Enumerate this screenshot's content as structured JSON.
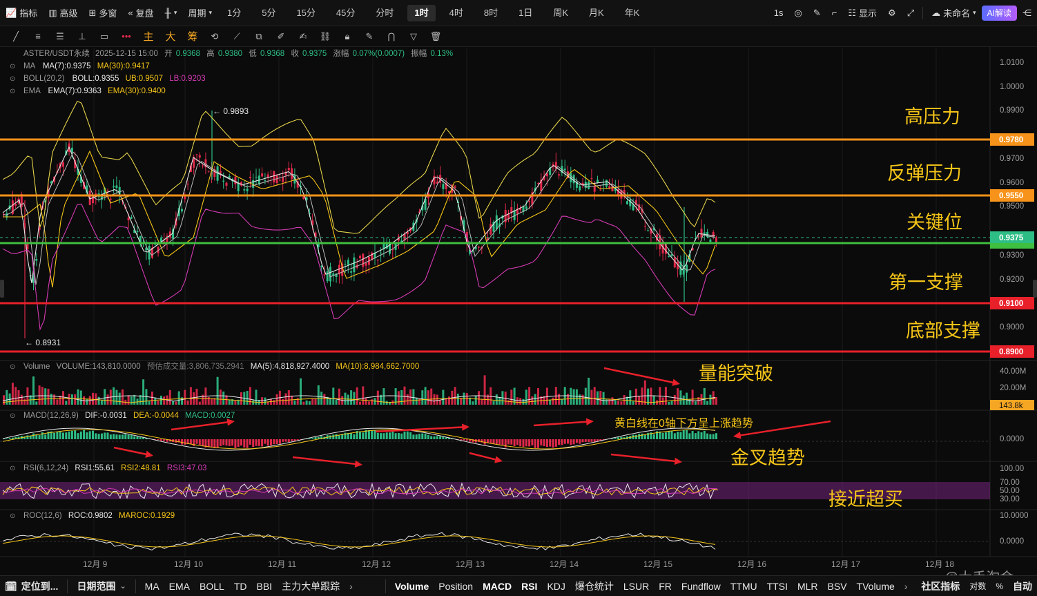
{
  "toolbar": {
    "indicator": "指标",
    "advanced": "高级",
    "multi_window": "多窗",
    "replay": "复盘",
    "period_menu": "周期",
    "periods": [
      "1分",
      "5分",
      "15分",
      "45分",
      "分时",
      "1时",
      "4时",
      "8时",
      "1日",
      "周K",
      "月K",
      "年K"
    ],
    "active_period": "1时",
    "interval_label": "1s",
    "display": "显示",
    "layout_name": "未命名",
    "ai_button": "AI解读"
  },
  "drawing_tools": {
    "main": "主",
    "big": "大",
    "chips": "筹"
  },
  "legends": {
    "ohlc": {
      "symbol": "ASTER/USDT永续",
      "datetime": "2025-12-15 15:00",
      "open_label": "开",
      "open": "0.9368",
      "high_label": "高",
      "high": "0.9380",
      "low_label": "低",
      "low": "0.9368",
      "close_label": "收",
      "close": "0.9375",
      "change_label": "涨幅",
      "change": "0.07%(0.0007)",
      "amplitude_label": "振幅",
      "amplitude": "0.13%"
    },
    "ma": {
      "name": "MA",
      "ma7": "MA(7):0.9375",
      "ma30": "MA(30):0.9417"
    },
    "boll": {
      "name": "BOLL(20,2)",
      "boll": "BOLL:0.9355",
      "ub": "UB:0.9507",
      "lb": "LB:0.9203"
    },
    "ema": {
      "name": "EMA",
      "ema7": "EMA(7):0.9363",
      "ema30": "EMA(30):0.9400"
    },
    "volume": {
      "name": "Volume",
      "vol": "VOLUME:143,810.0000",
      "est": "预估成交量:3,806,735.2941",
      "ma5": "MA(5):4,818,927.4000",
      "ma10": "MA(10):8,984,662.7000"
    },
    "macd": {
      "name": "MACD(12,26,9)",
      "dif": "DIF:-0.0031",
      "dea": "DEA:-0.0044",
      "macd": "MACD:0.0027"
    },
    "rsi": {
      "name": "RSI(6,12,24)",
      "rsi1": "RSI1:55.61",
      "rsi2": "RSI2:48.81",
      "rsi3": "RSI3:47.03"
    },
    "roc": {
      "name": "ROC(12,6)",
      "roc": "ROC:0.9802",
      "maroc": "MAROC:0.1929"
    }
  },
  "price_axis": [
    "1.0100",
    "1.0000",
    "0.9900",
    "0.9700",
    "0.9600",
    "0.9500",
    "0.9300",
    "0.9200",
    "0.9000"
  ],
  "price_tags": {
    "line_978": "0.9780",
    "line_955": "0.9550",
    "current": "0.9375",
    "line_910": "0.9100",
    "line_890": "0.8900"
  },
  "chart_marks": {
    "high_mark": "← 0.9893",
    "low_mark": "← 0.8931"
  },
  "annotations": {
    "high_pressure": "高压力",
    "rebound_pressure": "反弹压力",
    "key_level": "关键位",
    "first_support": "第一支撑",
    "bottom_support": "底部支撑",
    "volume_breakout": "量能突破",
    "macd_note": "黄白线在0轴下方呈上涨趋势",
    "golden_cross": "金叉趋势",
    "near_overbought": "接近超买"
  },
  "volume_axis": [
    "40.00M",
    "20.00M"
  ],
  "volume_tag": "143.8k",
  "macd_axis": [
    "0.0000"
  ],
  "rsi_axis": [
    "100.00",
    "70.00",
    "50.00",
    "30.00"
  ],
  "roc_axis": [
    "10.0000",
    "0.0000"
  ],
  "date_axis": [
    "12月 9",
    "12月 10",
    "12月 11",
    "12月 12",
    "12月 13",
    "12月 14",
    "12月 15",
    "12月 16",
    "12月 17",
    "12月 18"
  ],
  "bottom_bar": {
    "locate": "定位到...",
    "date_range": "日期范围",
    "overlays": [
      "MA",
      "EMA",
      "BOLL",
      "TD",
      "BBI",
      "主力大单跟踪"
    ],
    "subcharts": [
      "Volume",
      "Position",
      "MACD",
      "RSI",
      "KDJ",
      "爆仓统计",
      "LSUR",
      "FR",
      "Fundflow",
      "TTMU",
      "TTSI",
      "MLR",
      "BSV",
      "TVolume"
    ],
    "corner": [
      "社区指标",
      "对数",
      "%",
      "自动"
    ]
  },
  "watermark": "@大手淘金",
  "colors": {
    "up": "#2ebd85",
    "down": "#e0294a",
    "orange_line": "#f7931a",
    "green_line": "#3fbf3f",
    "red_line": "#e8202a",
    "accent": "#f5c518"
  }
}
